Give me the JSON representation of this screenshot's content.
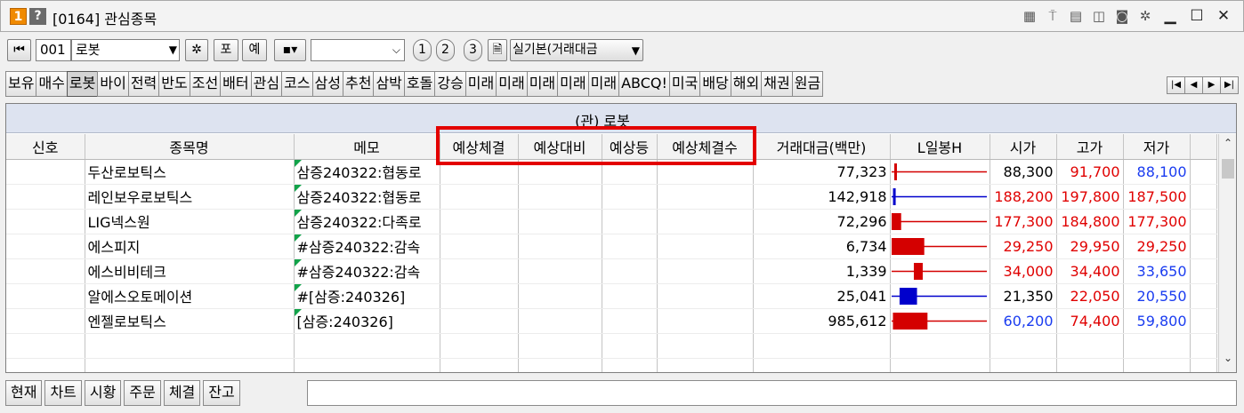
{
  "window": {
    "badge_num": "1",
    "help": "?",
    "title": "[0164] 관심종목",
    "icons": [
      "grid-icon",
      "pin-icon",
      "memo-icon",
      "save-icon",
      "camera-icon",
      "gear-icon",
      "minimize-icon",
      "maximize-icon",
      "close-icon"
    ]
  },
  "toolbar": {
    "prev_label": "⏮",
    "group_no": "001",
    "group_name": "로봇",
    "gear": "✲",
    "btn_po": "포",
    "btn_ye": "예",
    "btn_sq": "▪▾",
    "empty_combo": "",
    "num1": "1",
    "num2": "2",
    "num3": "3",
    "doc_icon": "🗎",
    "sort_select": "실기본(거래대금"
  },
  "categories": [
    "보유",
    "매수",
    "로봇",
    "바이",
    "전력",
    "반도",
    "조선",
    "배터",
    "관심",
    "코스",
    "삼성",
    "추천",
    "삼박",
    "호돌",
    "강승",
    "미래",
    "미래",
    "미래",
    "미래",
    "미래",
    "ABCQ!",
    "미국",
    "배당",
    "해외",
    "채권",
    "원금"
  ],
  "active_category": "로봇",
  "grid": {
    "group_title": "(관) 로봇",
    "headers": [
      "신호",
      "종목명",
      "메모",
      "예상체결",
      "예상대비",
      "예상등",
      "예상체결수",
      "거래대금(백만)",
      "L일봉H",
      "시가",
      "고가",
      "저가"
    ],
    "rows": [
      {
        "signal": "",
        "name": "두산로보틱스",
        "memo": "삼증240322:협동로",
        "exp": "",
        "expdiff": "",
        "expsign": "",
        "expcnt": "",
        "amount": "77,323",
        "candle": {
          "low": 88100,
          "high": 91700,
          "open": 88300,
          "close": 88300
        },
        "open": "88,300",
        "high": "91,700",
        "low": "88,100",
        "open_c": "black",
        "high_c": "red",
        "low_c": "blue"
      },
      {
        "signal": "",
        "name": "레인보우로보틱스",
        "memo": "삼증240322:협동로",
        "exp": "",
        "expdiff": "",
        "expsign": "",
        "expcnt": "",
        "amount": "142,918",
        "candle": {
          "low": 187500,
          "high": 197800,
          "open": 188200,
          "close": 187800
        },
        "open": "188,200",
        "high": "197,800",
        "low": "187,500",
        "open_c": "red",
        "high_c": "red",
        "low_c": "red"
      },
      {
        "signal": "",
        "name": "LIG넥스원",
        "memo": "삼증240322:다족로",
        "exp": "",
        "expdiff": "",
        "expsign": "",
        "expcnt": "",
        "amount": "72,296",
        "candle": {
          "low": 177300,
          "high": 184800,
          "open": 177300,
          "close": 178800
        },
        "open": "177,300",
        "high": "184,800",
        "low": "177,300",
        "open_c": "red",
        "high_c": "red",
        "low_c": "red"
      },
      {
        "signal": "",
        "name": "에스피지",
        "memo": "#삼증240322:감속",
        "exp": "",
        "expdiff": "",
        "expsign": "",
        "expcnt": "",
        "amount": "6,734",
        "candle": {
          "low": 29250,
          "high": 29950,
          "open": 29250,
          "close": 29730
        },
        "open": "29,250",
        "high": "29,950",
        "low": "29,250",
        "open_c": "red",
        "high_c": "red",
        "low_c": "red"
      },
      {
        "signal": "",
        "name": "에스비비테크",
        "memo": "#삼증240322:감속",
        "exp": "",
        "expdiff": "",
        "expsign": "",
        "expcnt": "",
        "amount": "1,339",
        "candle": {
          "low": 33650,
          "high": 34400,
          "open": 34000,
          "close": 34140
        },
        "open": "34,000",
        "high": "34,400",
        "low": "33,650",
        "open_c": "red",
        "high_c": "red",
        "low_c": "blue"
      },
      {
        "signal": "",
        "name": "알에스오토메이션",
        "memo": "#[삼증:240326]",
        "exp": "",
        "expdiff": "",
        "expsign": "",
        "expcnt": "",
        "amount": "25,041",
        "candle": {
          "low": 20550,
          "high": 22050,
          "open": 21350,
          "close": 20800
        },
        "open": "21,350",
        "high": "22,050",
        "low": "20,550",
        "open_c": "black",
        "high_c": "red",
        "low_c": "blue"
      },
      {
        "signal": "",
        "name": "엔젤로보틱스",
        "memo": "[삼증:240326]",
        "exp": "",
        "expdiff": "",
        "expsign": "",
        "expcnt": "",
        "amount": "985,612",
        "candle": {
          "low": 59800,
          "high": 74400,
          "open": 60200,
          "close": 70800
        },
        "open": "60,200",
        "high": "74,400",
        "low": "59,800",
        "open_c": "blue",
        "high_c": "red",
        "low_c": "blue"
      }
    ]
  },
  "colors": {
    "up": "#d40000",
    "down": "#0000cc",
    "highlight": "#e30000",
    "memo_flag": "#12a34a"
  },
  "bottom_tabs": [
    "현재",
    "차트",
    "시황",
    "주문",
    "체결",
    "잔고"
  ]
}
